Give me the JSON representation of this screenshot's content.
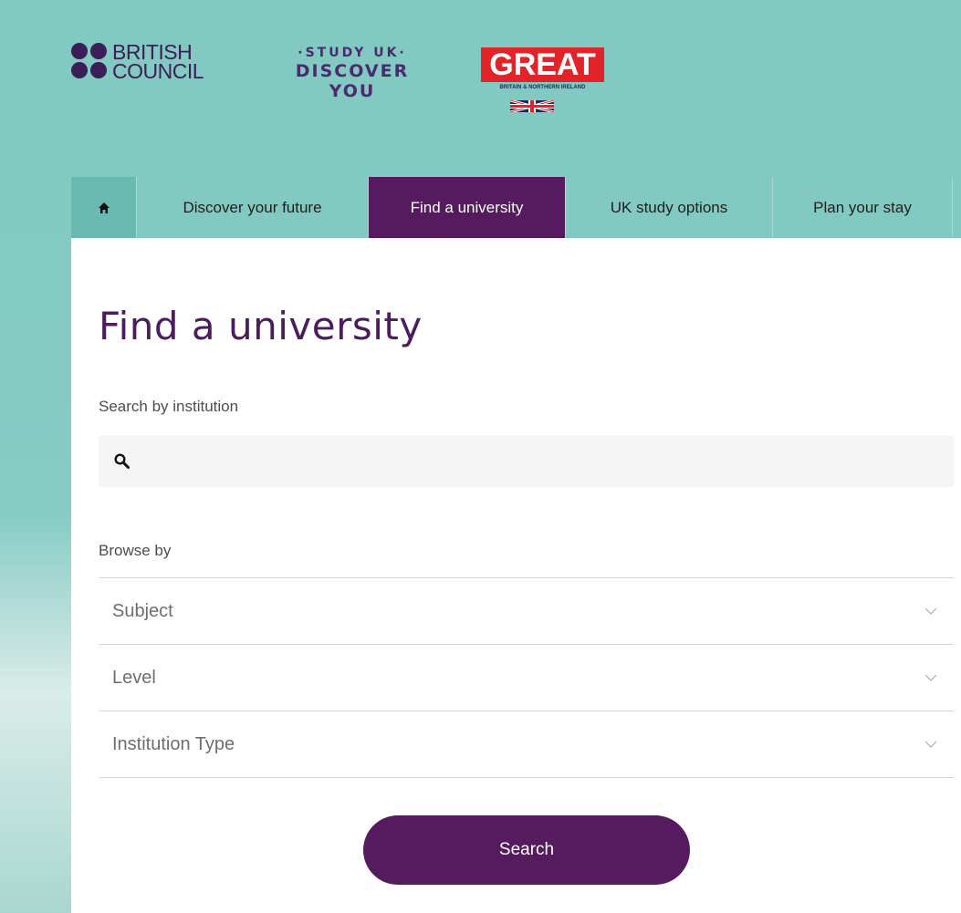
{
  "header": {
    "british_council": {
      "line1": "BRITISH",
      "line2": "COUNCIL"
    },
    "study_uk": {
      "line1": "·STUDY UK·",
      "line2": "DISCOVER",
      "line3": "YOU"
    },
    "great": {
      "word": "GREAT",
      "subtitle": "BRITAIN & NORTHERN IRELAND"
    }
  },
  "nav": {
    "home_icon": "home-icon",
    "items": [
      {
        "label": "Discover your future"
      },
      {
        "label": "Find a university",
        "active": true
      },
      {
        "label": "UK study options"
      },
      {
        "label": "Plan your stay"
      }
    ]
  },
  "main": {
    "title": "Find a university",
    "search_label": "Search by institution",
    "search_placeholder": "",
    "search_icon": "search-icon",
    "browse_label": "Browse by",
    "filters": [
      {
        "label": "Subject"
      },
      {
        "label": "Level"
      },
      {
        "label": "Institution Type"
      }
    ],
    "search_button": "Search"
  },
  "colors": {
    "header_bg": "#82c9c1",
    "accent_purple": "#561b5e",
    "title_purple": "#4b1d5c",
    "great_red": "#e3232a"
  }
}
